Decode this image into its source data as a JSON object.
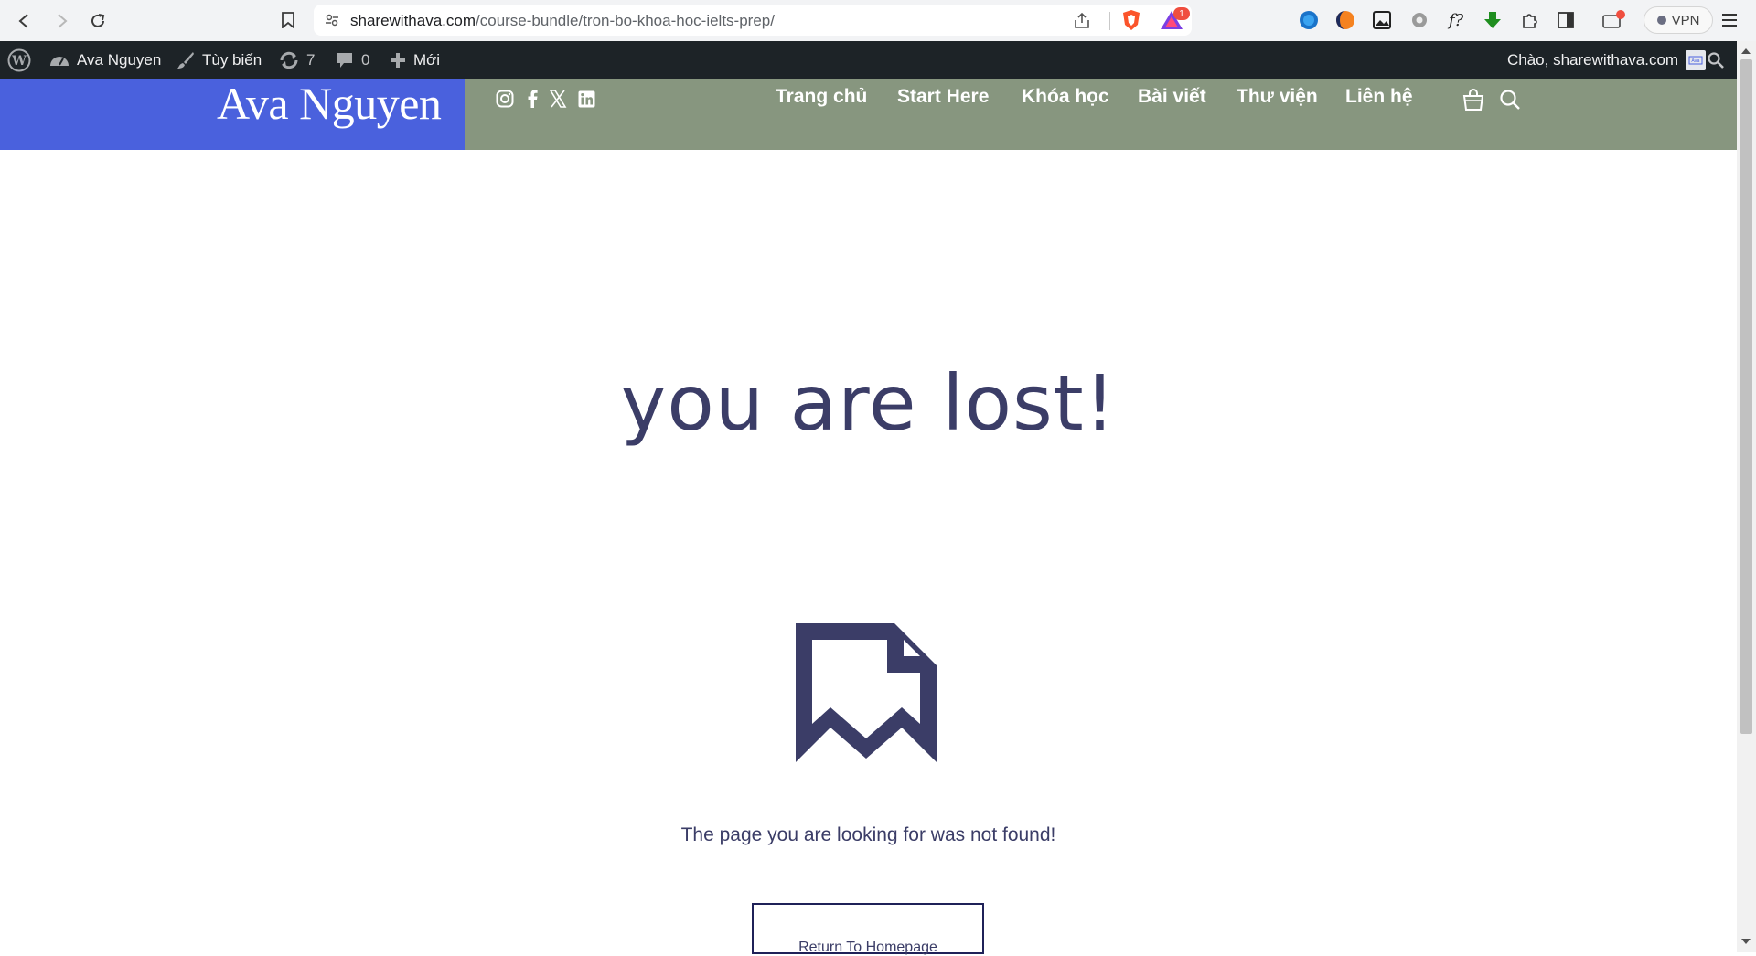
{
  "browser": {
    "url_host": "sharewithava.com",
    "url_path": "/course-bundle/tron-bo-khoa-hoc-ielts-prep/",
    "rewards_badge": "1",
    "vpn_label": "VPN",
    "extensions": [
      "globe-extension-icon",
      "half-moon-extension-icon",
      "image-extension-icon",
      "gear-extension-icon",
      "formula-extension-icon",
      "download-extension-icon",
      "puzzle-extensions-icon",
      "sidebar-icon",
      "wallet-icon"
    ]
  },
  "admin_bar": {
    "site_name": "Ava Nguyen",
    "customize_label": "Tùy biến",
    "updates_count": "7",
    "comments_count": "0",
    "new_label": "Mới",
    "greeting": "Chào, sharewithava.com"
  },
  "header": {
    "logo_text": "Ava Nguyen",
    "logo_bg": "#4a61dd",
    "nav_bg": "#87967f",
    "social": [
      "instagram-icon",
      "facebook-icon",
      "x-icon",
      "linkedin-icon"
    ],
    "nav": [
      {
        "label": "Trang chủ"
      },
      {
        "label": "Start Here"
      },
      {
        "label": "Khóa học"
      },
      {
        "label": "Bài viết"
      },
      {
        "label": "Thư viện"
      },
      {
        "label": "Liên hệ"
      }
    ]
  },
  "main": {
    "headline": "you are lost!",
    "message": "The page you are looking for was not found!",
    "button_label": "Return To Homepage",
    "accent_color": "#3b3d67"
  }
}
